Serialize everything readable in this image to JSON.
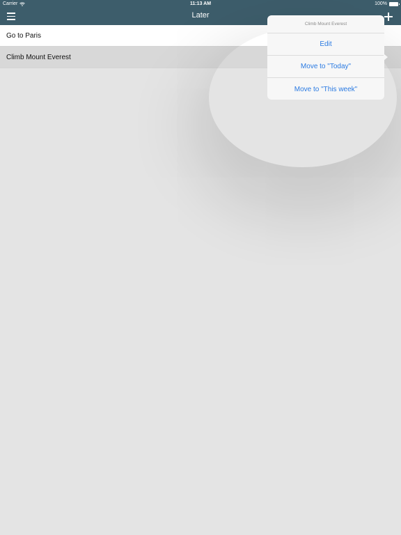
{
  "status_bar": {
    "carrier": "Carrier",
    "time": "11:13 AM",
    "battery": "100%"
  },
  "nav": {
    "title": "Later",
    "menu_icon": "hamburger-menu-icon",
    "add_icon": "plus-icon"
  },
  "tasks": [
    {
      "label": "Go to Paris",
      "selected": false
    },
    {
      "label": "Climb Mount Everest",
      "selected": true
    }
  ],
  "popover": {
    "title": "Climb Mount Everest",
    "actions": [
      {
        "label": "Edit"
      },
      {
        "label": "Move to \"Today\""
      },
      {
        "label": "Move to \"This week\""
      }
    ]
  },
  "colors": {
    "header_bg": "#3d5d6b",
    "action_text": "#2a7ae2",
    "page_bg": "#e4e4e4"
  }
}
